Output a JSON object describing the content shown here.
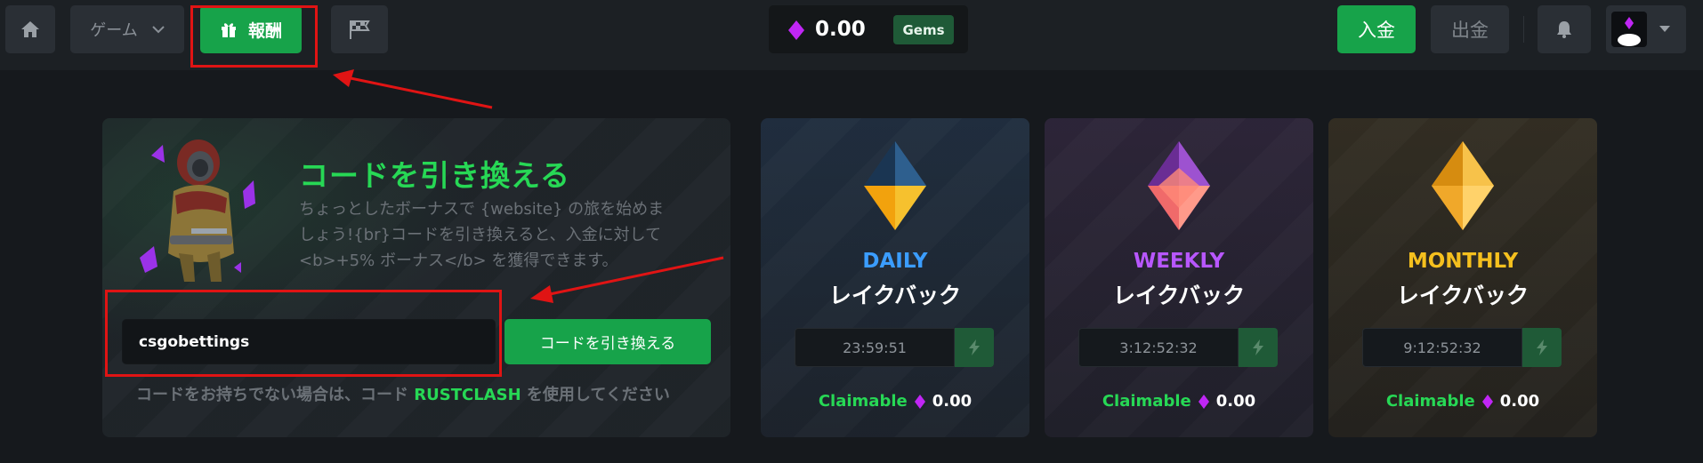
{
  "topbar": {
    "games_label": "ゲーム",
    "rewards_label": "報酬",
    "balance_value": "0.00",
    "gems_label": "Gems",
    "deposit_label": "入金",
    "withdraw_label": "出金"
  },
  "redeem": {
    "title": "コードを引き換える",
    "description": "ちょっとしたボーナスで {website} の旅を始めましょう!{br}コードを引き換えると、入金に対して <b>+5% ボーナス</b> を獲得できます。",
    "code_value": "csgobettings",
    "button_label": "コードを引き換える",
    "hint_prefix": "コードをお持ちでない場合は、コード",
    "hint_code": "RUSTCLASH",
    "hint_suffix": "を使用してください"
  },
  "rakeback": [
    {
      "period": "DAILY",
      "label": "レイクバック",
      "timer": "23:59:51",
      "claimable_label": "Claimable",
      "claimable_value": "0.00",
      "color": "#3b9dff"
    },
    {
      "period": "WEEKLY",
      "label": "レイクバック",
      "timer": "3:12:52:32",
      "claimable_label": "Claimable",
      "claimable_value": "0.00",
      "color": "#b857ff"
    },
    {
      "period": "MONTHLY",
      "label": "レイクバック",
      "timer": "9:12:52:32",
      "claimable_label": "Claimable",
      "claimable_value": "0.00",
      "color": "#f5c01e"
    }
  ],
  "colors": {
    "accent_green": "#17a34a",
    "highlight_red": "#e01414"
  },
  "icons": [
    "home-icon",
    "chevron-down-icon",
    "gift-icon",
    "flag-icon",
    "gem-icon",
    "bell-icon",
    "caret-down-icon",
    "lightning-icon"
  ]
}
